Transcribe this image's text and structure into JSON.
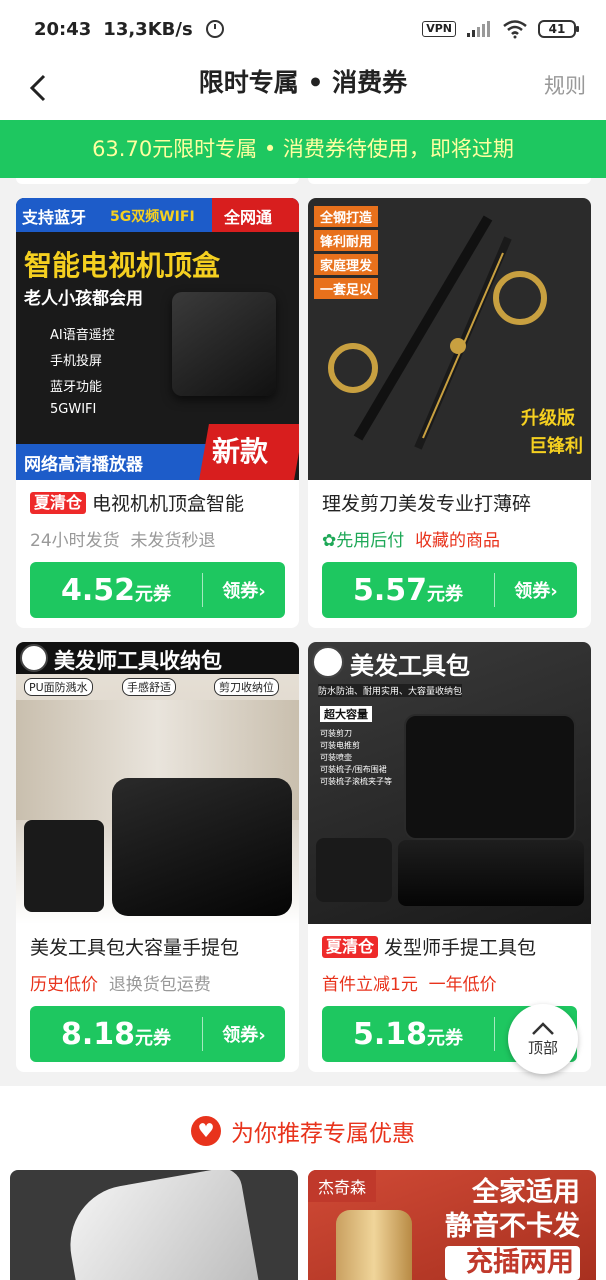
{
  "status": {
    "time": "20:43",
    "speed": "13,3KB/s",
    "vpn": "VPN",
    "battery": "41"
  },
  "nav": {
    "title": "限时专属 • 消费券",
    "rules": "规则"
  },
  "banner": {
    "text": "63.70元限时专属 • 消费券待使用，即将过期"
  },
  "products": [
    {
      "image_texts": [
        "支持蓝牙",
        "5G双频WIFI",
        "全网通",
        "智能电视机顶盒",
        "老人小孩都会用",
        "AI语音遥控",
        "手机投屏",
        "蓝牙功能",
        "5GWIFI",
        "网络高清播放器",
        "新款"
      ],
      "tag": "夏清仓",
      "title": "电视机机顶盒智能",
      "subs": [
        "24小时发货",
        "未发货秒退"
      ],
      "amount": "4.52",
      "unit": "元券",
      "action": "领券"
    },
    {
      "image_texts": [
        "全钢打造",
        "锋利耐用",
        "家庭理发",
        "一套足以",
        "升级版",
        "巨锋利"
      ],
      "tag": "",
      "title": "理发剪刀美发专业打薄碎",
      "subs": [
        "先用后付",
        "收藏的商品"
      ],
      "amount": "5.57",
      "unit": "元券",
      "action": "领券"
    },
    {
      "image_texts": [
        "美发师工具收纳包",
        "PU面防溅水",
        "手感舒适",
        "剪刀收纳位"
      ],
      "tag": "",
      "title": "美发工具包大容量手提包",
      "subs": [
        "历史低价",
        "退换货包运费"
      ],
      "amount": "8.18",
      "unit": "元券",
      "action": "领券"
    },
    {
      "image_texts": [
        "美发工具包",
        "防水防油、耐用实用、大容量收纳包",
        "超大容量",
        "可装剪刀",
        "可装电推剪",
        "可装喷壶",
        "可装梳子/围布围裙",
        "可装梳子滚梳夹子等"
      ],
      "tag": "夏清仓",
      "title": "发型师手提工具包",
      "subs": [
        "首件立减1元",
        "一年低价"
      ],
      "amount": "5.18",
      "unit": "元券",
      "action": "领券"
    }
  ],
  "recommend": {
    "title": "为你推荐专属优惠",
    "brand": "杰奇森",
    "slogan": [
      "全家适用",
      "静音不卡发",
      "充插两用"
    ]
  },
  "back_top": {
    "label": "顶部"
  },
  "colors": {
    "green": "#1ec760",
    "red": "#e8331c",
    "banner_text": "#ffffa0"
  }
}
